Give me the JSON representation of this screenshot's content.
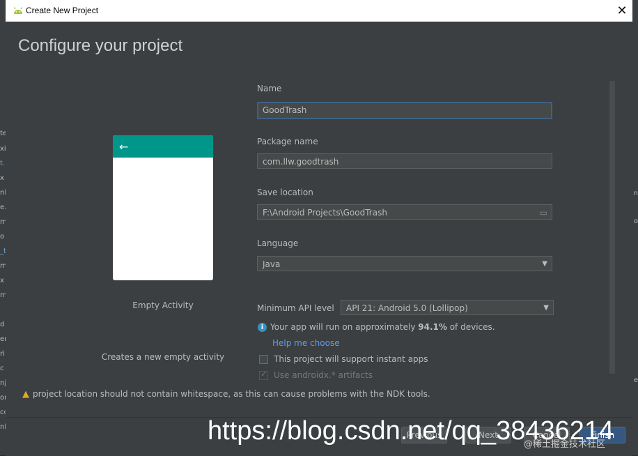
{
  "window": {
    "title": "Create New Project"
  },
  "heading": "Configure your project",
  "template": {
    "name": "Empty Activity",
    "description": "Creates a new empty activity"
  },
  "form": {
    "name_label": "Name",
    "name_value": "GoodTrash",
    "package_label": "Package name",
    "package_value": "com.llw.goodtrash",
    "save_label": "Save location",
    "save_value": "F:\\Android Projects\\GoodTrash",
    "language_label": "Language",
    "language_value": "Java",
    "min_api_label": "Minimum API level",
    "min_api_value": "API 21: Android 5.0 (Lollipop)",
    "info_prefix": "Your app will run on approximately",
    "info_percent": "94.1%",
    "info_suffix": "of devices.",
    "help_link": "Help me choose",
    "instant_apps": "This project will support instant apps",
    "androidx": "Use androidx.* artifacts"
  },
  "warning": "project location should not contain whitespace, as this can cause problems with the NDK tools.",
  "footer": {
    "previous": "Previous",
    "next": "Next",
    "cancel": "Cancel",
    "finish": "Finish"
  },
  "watermark": {
    "url": "https://blog.csdn.net/qq_38436214",
    "tag": "@稀土掘金技术社区"
  },
  "colors": {
    "accent": "#00968a",
    "link": "#589df6",
    "warning": "#e0a91f",
    "info": "#3592c4"
  }
}
